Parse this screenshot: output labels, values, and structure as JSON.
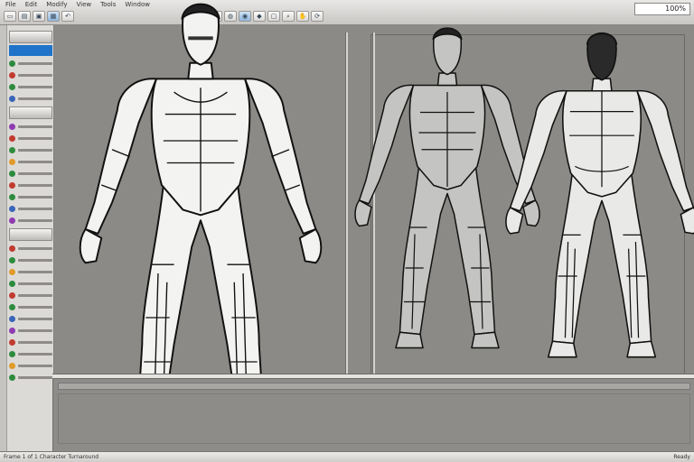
{
  "toolbar": {
    "menus": [
      "File",
      "Edit",
      "Modify",
      "View",
      "Tools",
      "Window"
    ],
    "zoom": "100%"
  },
  "statusbar": {
    "text": "Frame 1 of 1   Character Turnaround",
    "right": "Ready"
  },
  "canvas": {
    "views": [
      "front",
      "three-quarter",
      "back"
    ]
  },
  "colors": {
    "canvas": "#8c8a86",
    "palette_bg": "#dcdad7",
    "accent": "#1f73c9",
    "outline": "#111111",
    "figure_fill": "#f3f3f1",
    "figure_gray": "#bdbdbb"
  }
}
